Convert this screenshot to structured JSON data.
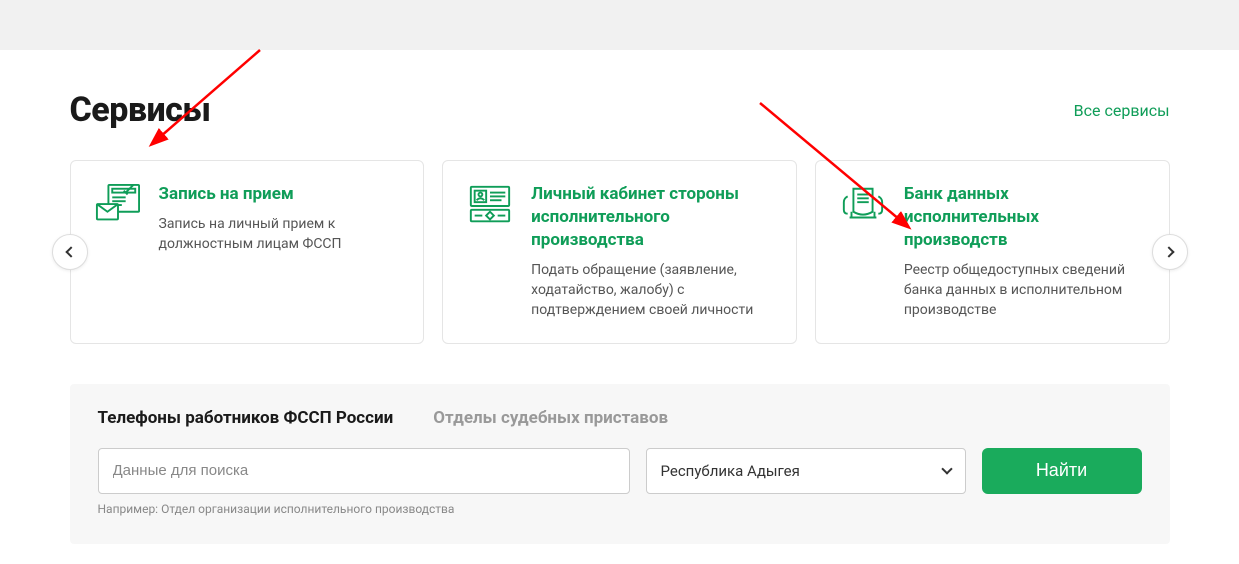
{
  "section": {
    "title": "Сервисы",
    "all_link": "Все сервисы"
  },
  "cards": [
    {
      "title": "Запись на прием",
      "desc": "Запись на личный прием к должностным лицам ФССП"
    },
    {
      "title": "Личный кабинет стороны исполнительного производства",
      "desc": "Подать обращение (заявление, ходатайство, жалобу) с подтверждением своей личности"
    },
    {
      "title": "Банк данных исполнительных производств",
      "desc": "Реестр общедоступных сведений банка данных в исполнительном производстве"
    }
  ],
  "search": {
    "tab1": "Телефоны работников ФССП России",
    "tab2": "Отделы судебных приставов",
    "placeholder": "Данные для поиска",
    "region": "Республика Адыгея",
    "button": "Найти",
    "hint": "Например: Отдел организации исполнительного производства"
  }
}
